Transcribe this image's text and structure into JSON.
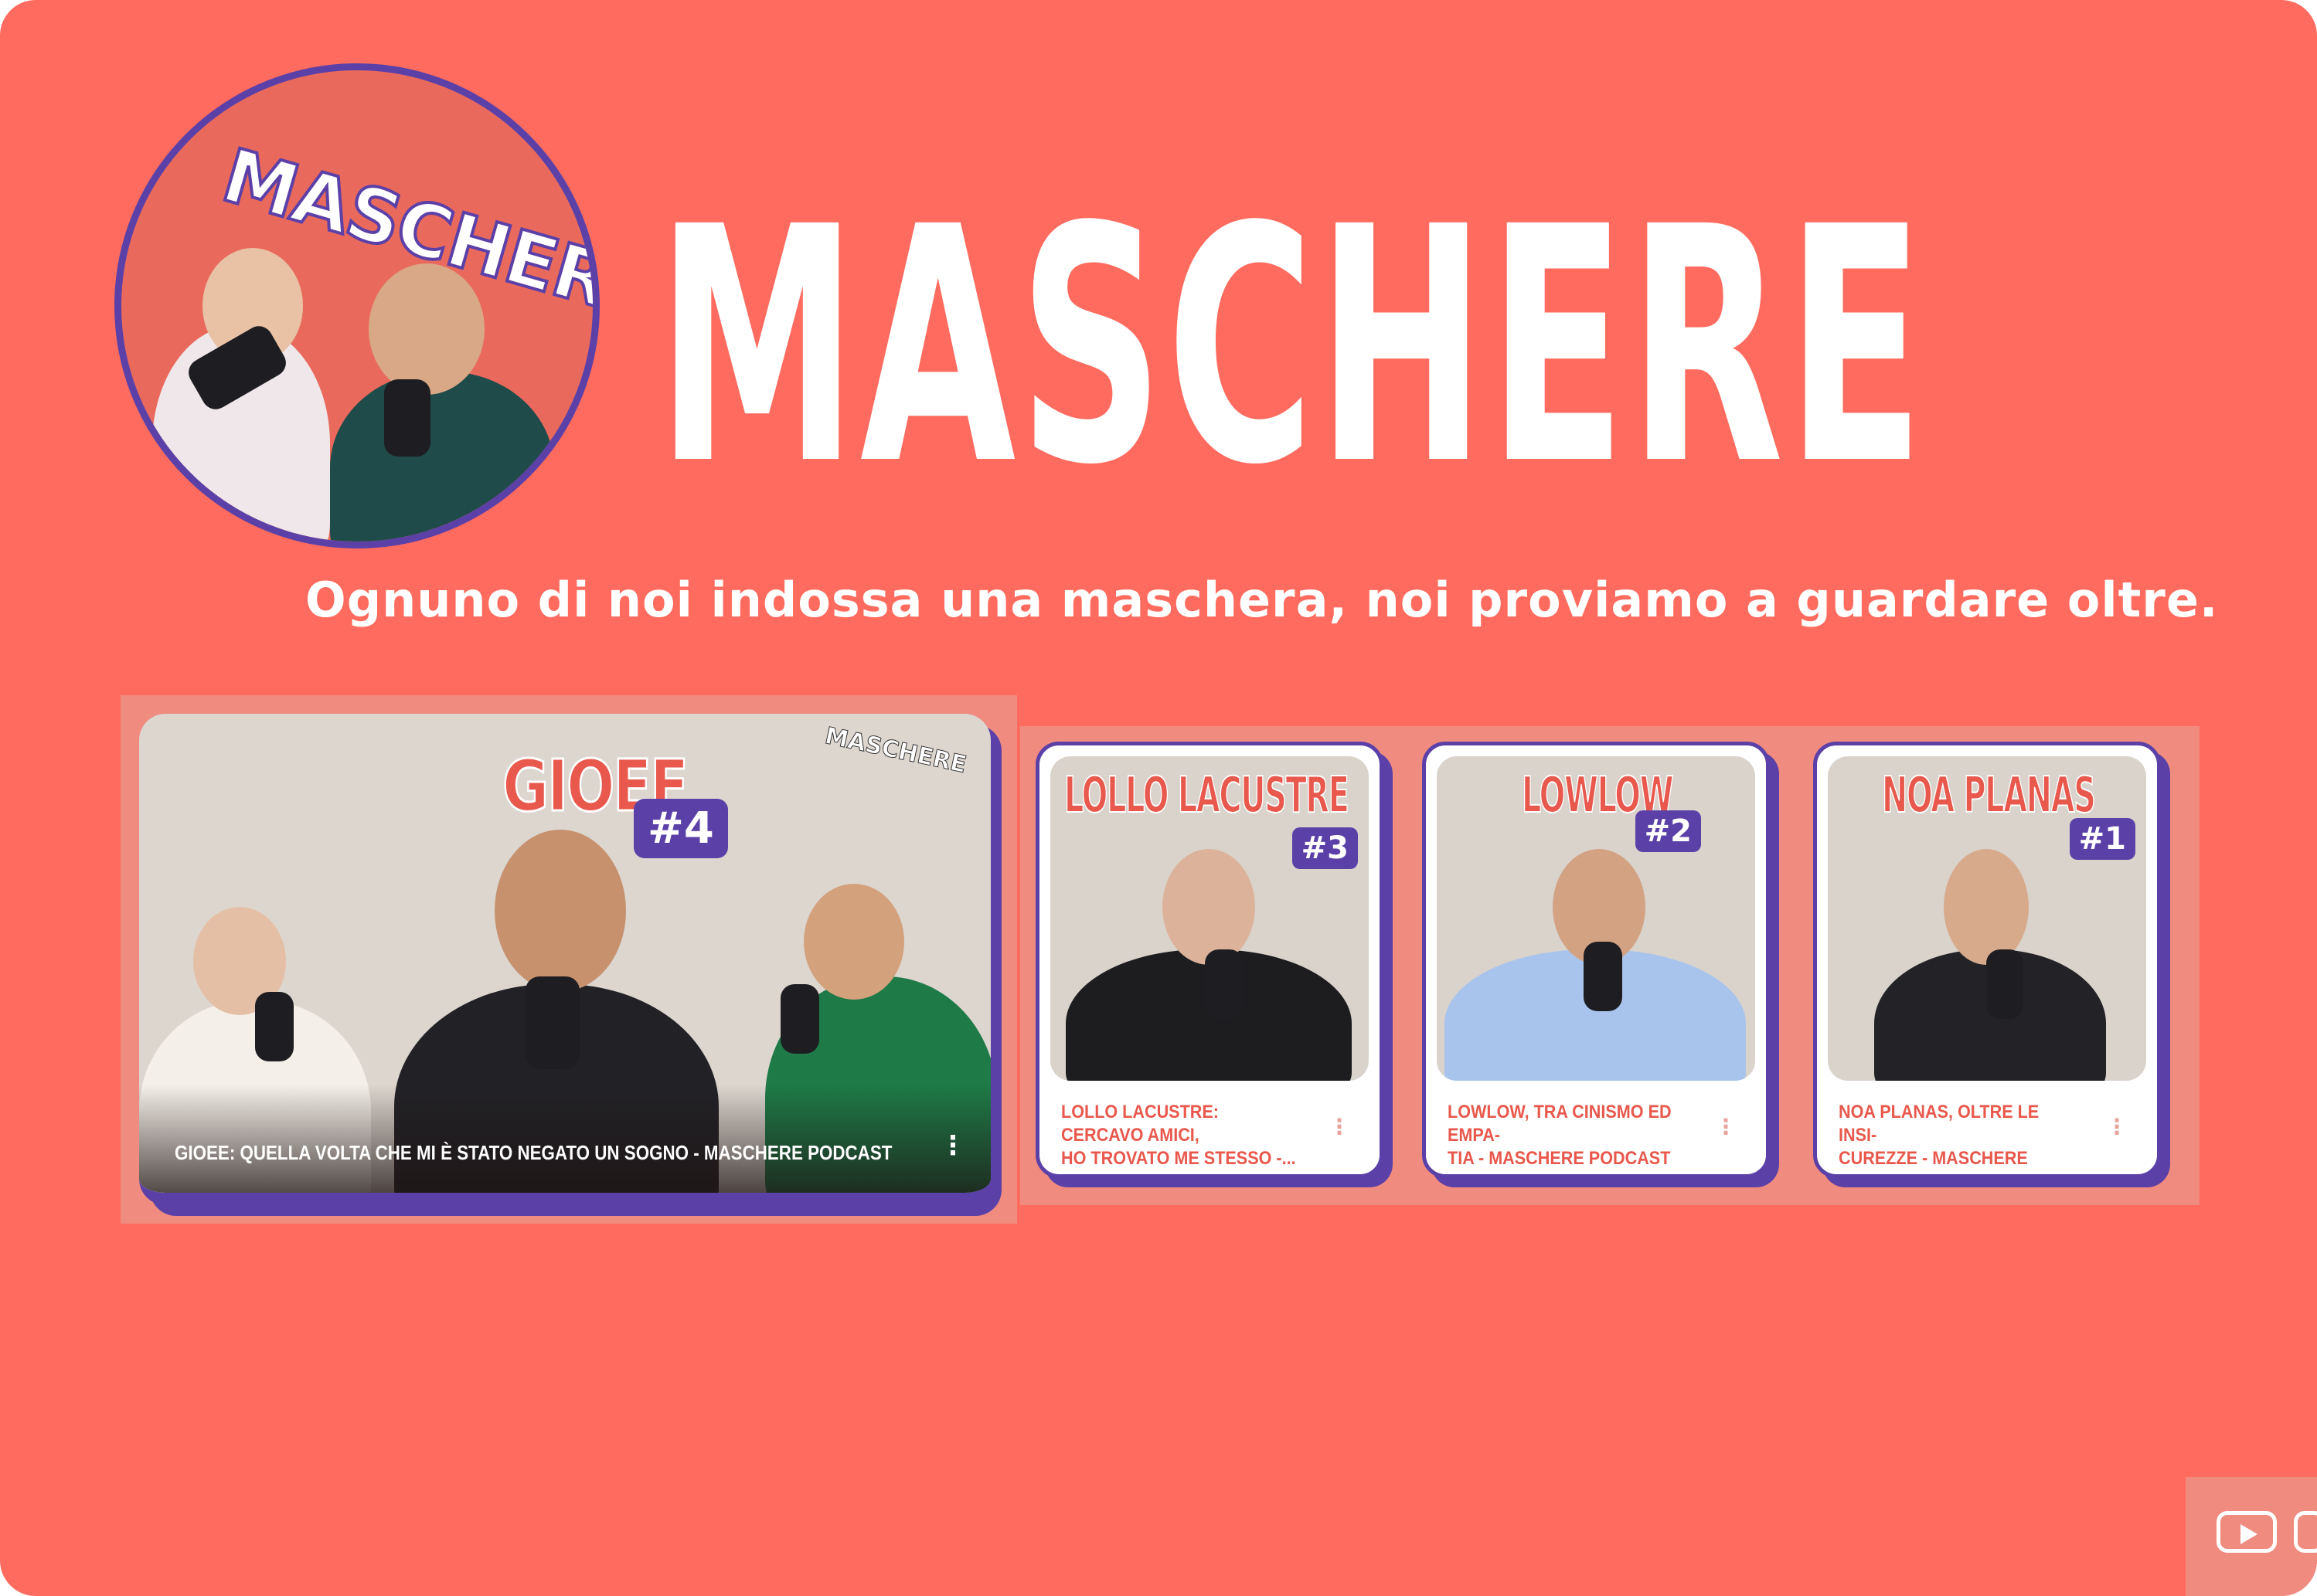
{
  "brand": {
    "name": "MASCHERE",
    "avatar_logo": "MASCHERE",
    "tagline": "Ognuno di noi indossa una maschera, noi proviamo a guardare oltre."
  },
  "featured_video": {
    "episode_name": "GIOEE",
    "episode_number": "#4",
    "channel_mark": "MASCHERE",
    "title": "GIOEE: QUELLA VOLTA CHE MI È STATO NEGATO UN SOGNO - MASCHERE PODCAST",
    "menu_icon": "kebab-menu-icon"
  },
  "videos": [
    {
      "episode_name": "LOLLO LACUSTRE",
      "episode_number": "#3",
      "title_line1": "LOLLO LACUSTRE: CERCAVO AMICI,",
      "title_line2": "HO TROVATO ME STESSO -...",
      "menu_icon": "kebab-menu-icon"
    },
    {
      "episode_name": "LOWLOW",
      "episode_number": "#2",
      "title_line1": "LOWLOW, TRA CINISMO ED EMPA-",
      "title_line2": "TIA - MASCHERE PODCAST",
      "menu_icon": "kebab-menu-icon"
    },
    {
      "episode_name": "NOA PLANAS",
      "episode_number": "#1",
      "title_line1": "NOA PLANAS, OLTRE LE INSI-",
      "title_line2": "CUREZZE - MASCHERE PODCAST",
      "menu_icon": "kebab-menu-icon"
    }
  ],
  "colors": {
    "background": "#ff6b5e",
    "accent_purple": "#5b40a8",
    "title_red": "#e8584c",
    "white": "#ffffff"
  },
  "icons": {
    "youtube": "youtube-play-icon",
    "menu": "kebab-menu-icon"
  }
}
